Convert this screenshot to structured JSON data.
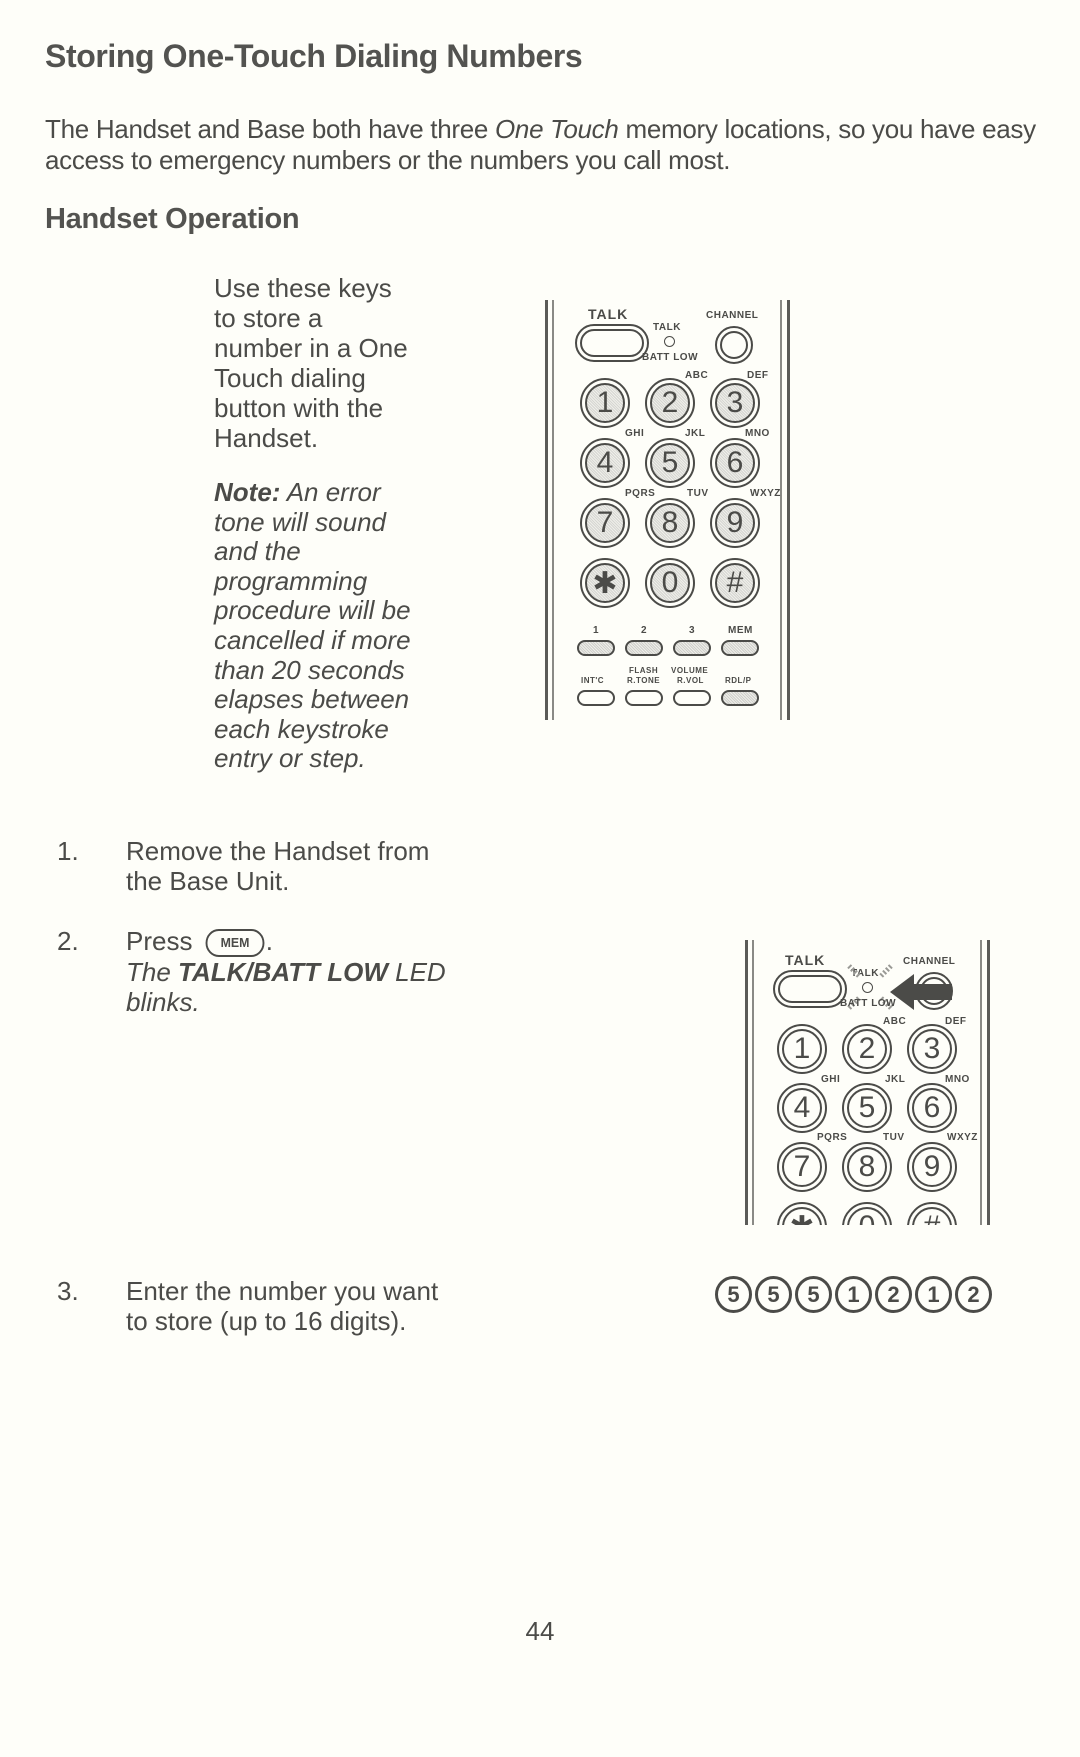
{
  "page": {
    "title": "Storing One-Touch Dialing Numbers",
    "intro": {
      "before": "The Handset and Base both have three ",
      "emph": "One Touch",
      "after": " memory locations, so you have easy access to emergency numbers or the numbers you call most."
    },
    "section_title": "Handset Operation",
    "side_text_lines": [
      "Use these keys",
      "to store a",
      "number in a One",
      "Touch dialing",
      "button with the",
      "Handset."
    ],
    "note": {
      "label": "Note:",
      "lines": [
        " An error",
        "tone will sound",
        "and the",
        "programming",
        "procedure will be",
        "cancelled if more",
        "than 20 seconds",
        "elapses between",
        "each keystroke",
        "entry or step."
      ]
    },
    "steps": [
      {
        "num": "1.",
        "lines": [
          "Remove the Handset from",
          "the Base Unit."
        ]
      },
      {
        "num": "2.",
        "press": "Press",
        "key": "MEM",
        "after": ".",
        "result_before": "The ",
        "result_bold": "TALK/BATT LOW",
        "result_after": " LED",
        "result_line2": "blinks."
      },
      {
        "num": "3.",
        "lines": [
          "Enter the number you want",
          "to store (up to 16 digits)."
        ]
      }
    ],
    "example_digits": [
      "5",
      "5",
      "5",
      "1",
      "2",
      "1",
      "2"
    ],
    "page_number": "44"
  },
  "handset_diagram": {
    "talk_label": "TALK",
    "led_top": "TALK",
    "led_bottom": "BATT LOW",
    "channel_label": "CHANNEL",
    "keys": [
      {
        "digit": "1",
        "letters": ""
      },
      {
        "digit": "2",
        "letters": "ABC"
      },
      {
        "digit": "3",
        "letters": "DEF"
      },
      {
        "digit": "4",
        "letters": "GHI"
      },
      {
        "digit": "5",
        "letters": "JKL"
      },
      {
        "digit": "6",
        "letters": "MNO"
      },
      {
        "digit": "7",
        "letters": "PQRS"
      },
      {
        "digit": "8",
        "letters": "TUV"
      },
      {
        "digit": "9",
        "letters": "WXYZ"
      },
      {
        "digit": "✱",
        "letters": ""
      },
      {
        "digit": "0",
        "letters": ""
      },
      {
        "digit": "#",
        "letters": ""
      }
    ],
    "memory_row": [
      "1",
      "2",
      "3",
      "MEM"
    ],
    "function_row": [
      {
        "line1": "",
        "line2": "INT'C"
      },
      {
        "line1": "FLASH",
        "line2": "R.TONE"
      },
      {
        "line1": "VOLUME",
        "line2": "R.VOL"
      },
      {
        "line1": "",
        "line2": "RDL/P"
      }
    ]
  }
}
